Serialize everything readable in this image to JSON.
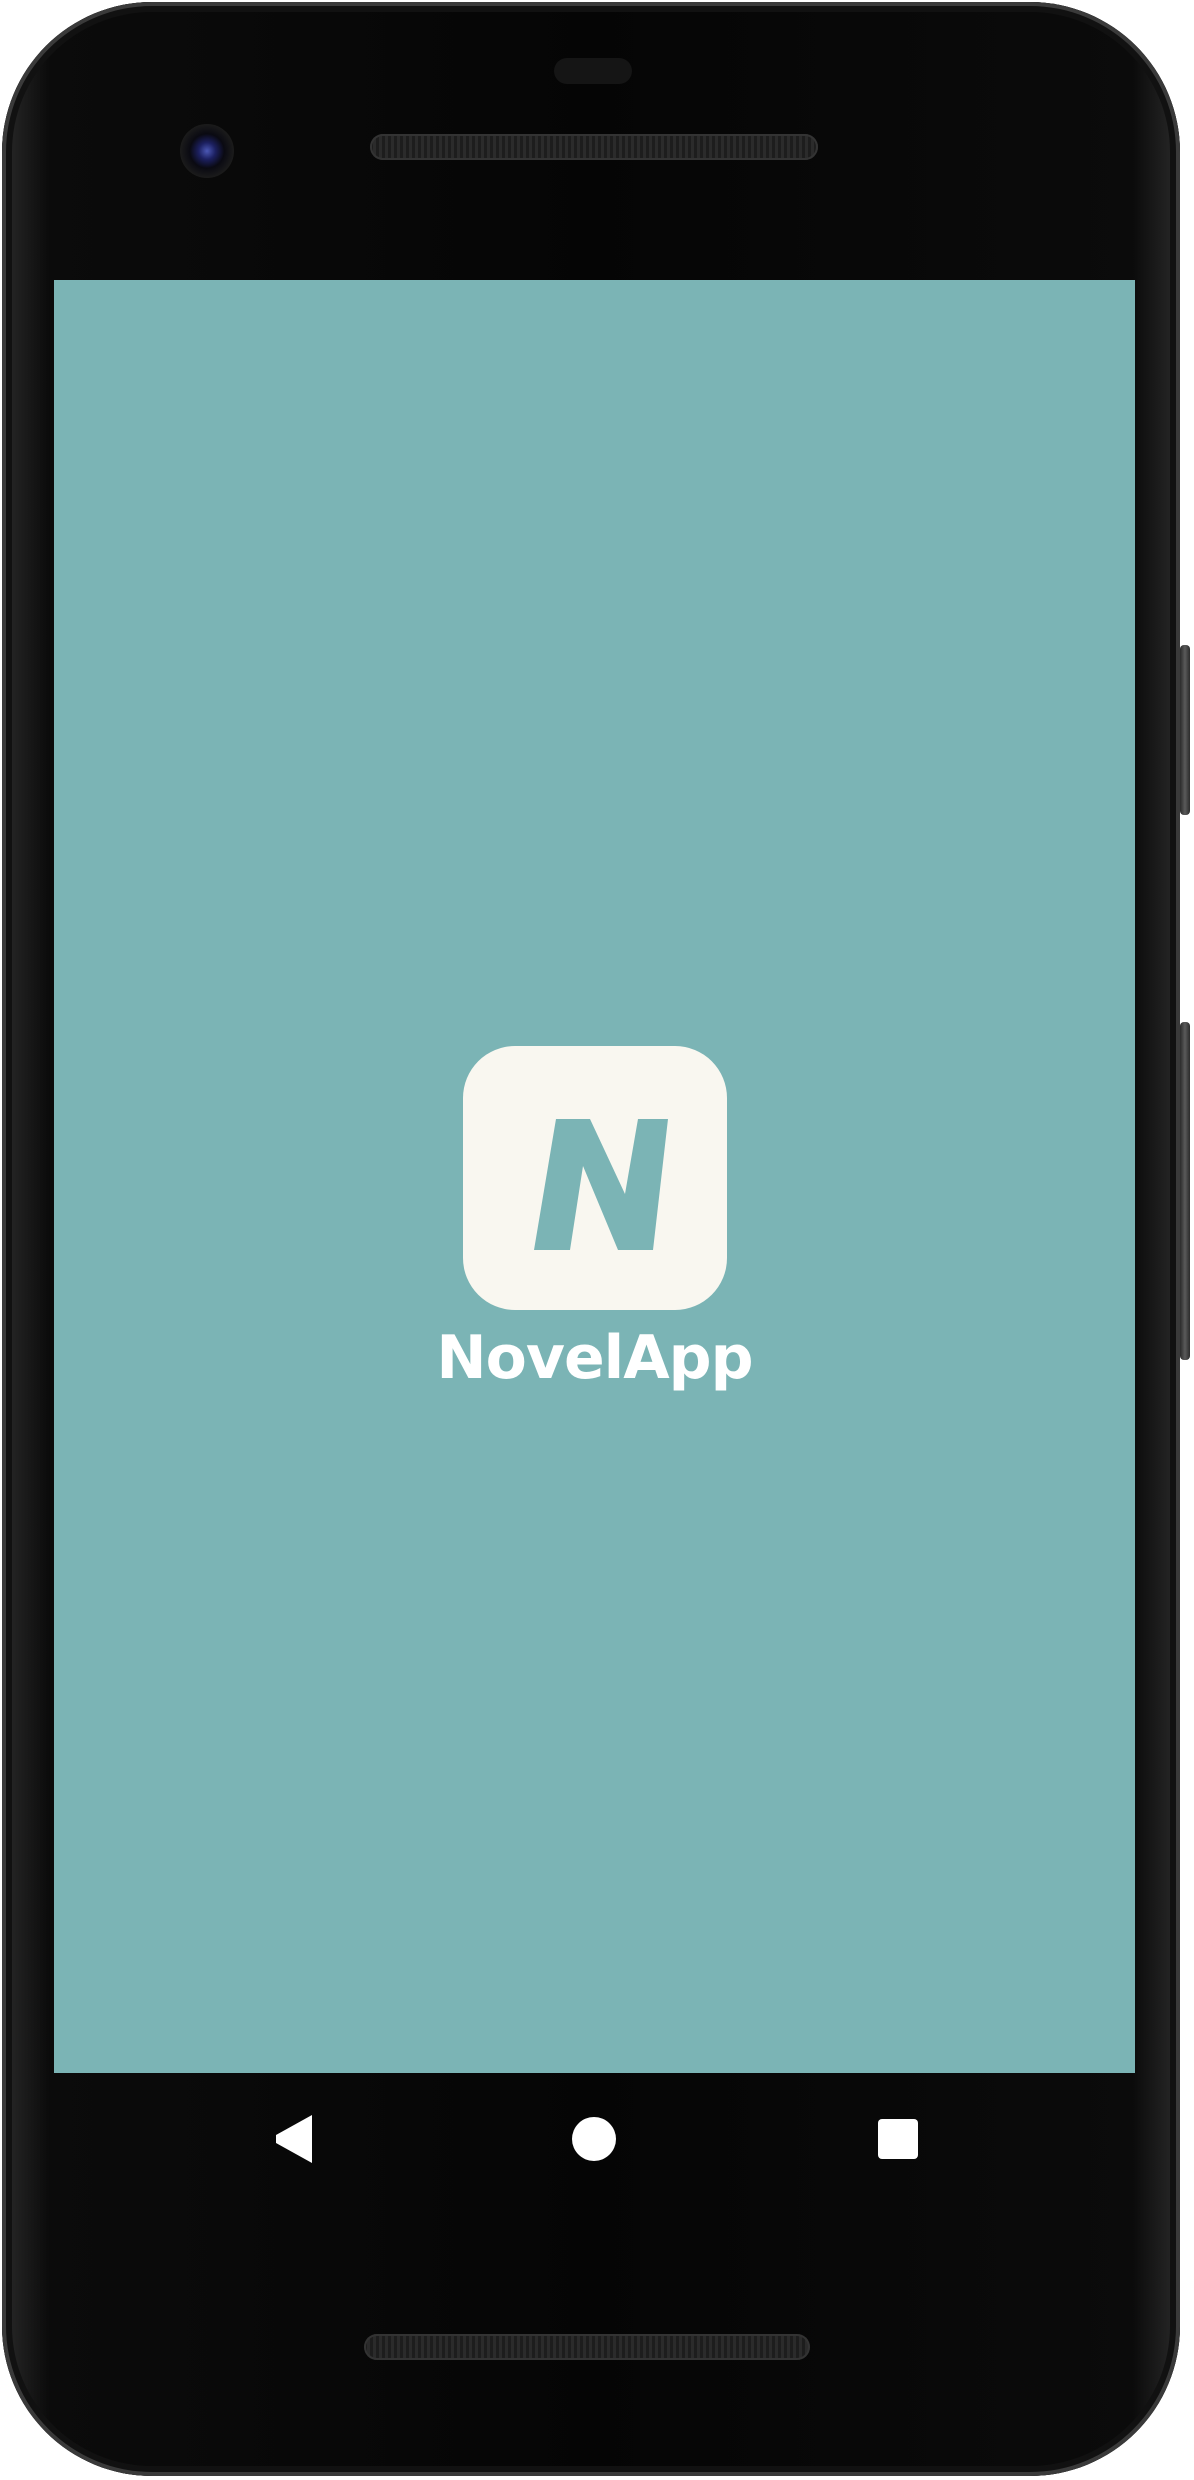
{
  "app": {
    "name": "NovelApp",
    "icon": "novelapp-logo-icon",
    "icon_letter": "N"
  },
  "colors": {
    "splash_background": "#7bb4b5",
    "icon_background": "#f9f7f0",
    "text": "#ffffff"
  },
  "navigation_bar": {
    "buttons": [
      {
        "name": "back",
        "icon": "back-triangle-icon"
      },
      {
        "name": "home",
        "icon": "home-circle-icon"
      },
      {
        "name": "recents",
        "icon": "recents-square-icon"
      }
    ]
  }
}
